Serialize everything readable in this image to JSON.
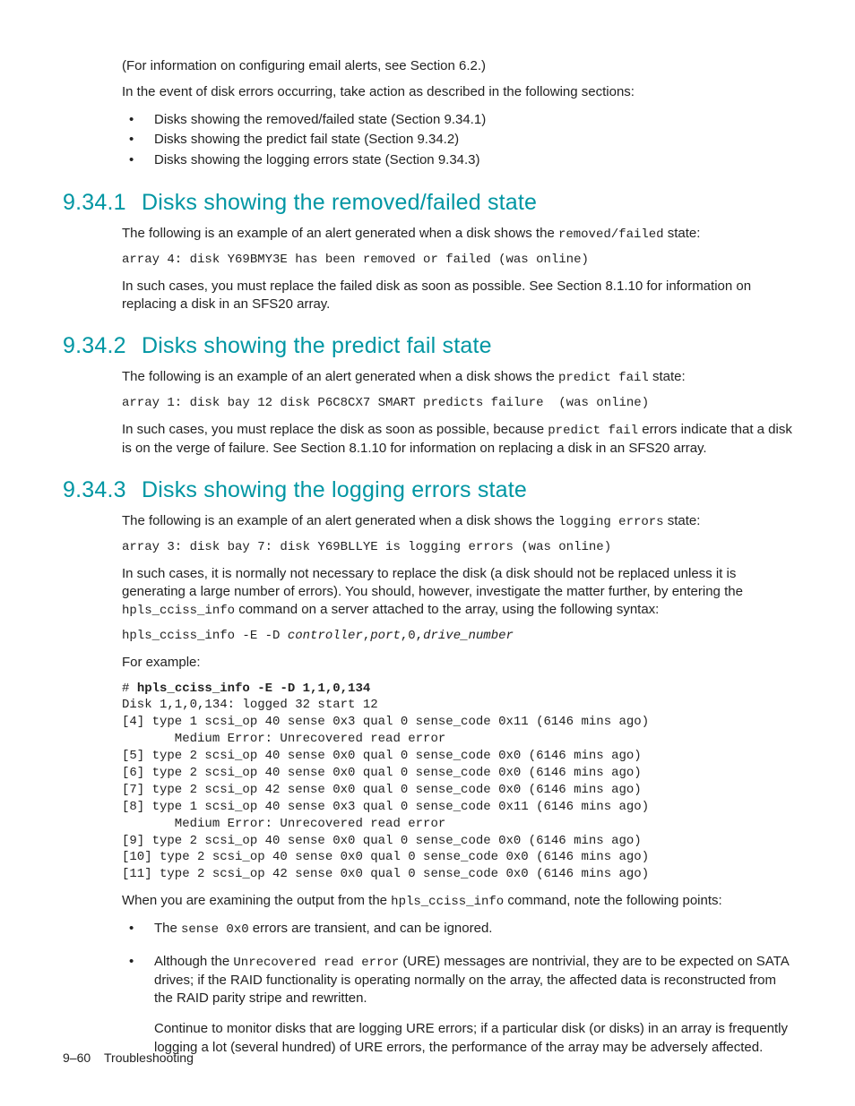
{
  "intro": {
    "p1": "(For information on configuring email alerts, see Section 6.2.)",
    "p2": "In the event of disk errors occurring, take action as described in the following sections:",
    "bullets": [
      "Disks showing the removed/failed state (Section 9.34.1)",
      "Disks showing the predict fail state (Section 9.34.2)",
      "Disks showing the logging errors state (Section 9.34.3)"
    ]
  },
  "s1": {
    "num": "9.34.1",
    "title": "Disks showing the removed/failed state",
    "p1a": "The following is an example of an alert generated when a disk shows the ",
    "p1code": "removed/failed",
    "p1b": " state:",
    "code1": "array 4: disk Y69BMY3E has been removed or failed (was online)",
    "p2": "In such cases, you must replace the failed disk as soon as possible. See Section 8.1.10 for information on replacing a disk in an SFS20 array."
  },
  "s2": {
    "num": "9.34.2",
    "title": "Disks showing the predict fail state",
    "p1a": "The following is an example of an alert generated when a disk shows the ",
    "p1code": "predict fail",
    "p1b": " state:",
    "code1": "array 1: disk bay 12 disk P6C8CX7 SMART predicts failure  (was online)",
    "p2a": "In such cases, you must replace the disk as soon as possible, because ",
    "p2code": "predict fail",
    "p2b": " errors indicate that a disk is on the verge of failure. See Section 8.1.10 for information on replacing a disk in an SFS20 array."
  },
  "s3": {
    "num": "9.34.3",
    "title": "Disks showing the logging errors state",
    "p1a": "The following is an example of an alert generated when a disk shows the ",
    "p1code": "logging errors",
    "p1b": " state:",
    "code1": "array 3: disk bay 7: disk Y69BLLYE is logging errors (was online)",
    "p2a": "In such cases, it is normally not necessary to replace the disk (a disk should not be replaced unless it is generating a large number of errors). You should, however, investigate the matter further, by entering the ",
    "p2code": "hpls_cciss_info",
    "p2b": " command on a server attached to the array, using the following syntax:",
    "syntax_a": "hpls_cciss_info -E -D ",
    "syntax_b": "controller",
    "syntax_c": ",",
    "syntax_d": "port",
    "syntax_e": ",0,",
    "syntax_f": "drive_number",
    "p3": "For example:",
    "example_cmd": "hpls_cciss_info -E -D 1,1,0,134",
    "example_out": "Disk 1,1,0,134: logged 32 start 12\n[4] type 1 scsi_op 40 sense 0x3 qual 0 sense_code 0x11 (6146 mins ago)\n       Medium Error: Unrecovered read error\n[5] type 2 scsi_op 40 sense 0x0 qual 0 sense_code 0x0 (6146 mins ago)\n[6] type 2 scsi_op 40 sense 0x0 qual 0 sense_code 0x0 (6146 mins ago)\n[7] type 2 scsi_op 42 sense 0x0 qual 0 sense_code 0x0 (6146 mins ago)\n[8] type 1 scsi_op 40 sense 0x3 qual 0 sense_code 0x11 (6146 mins ago)\n       Medium Error: Unrecovered read error\n[9] type 2 scsi_op 40 sense 0x0 qual 0 sense_code 0x0 (6146 mins ago)\n[10] type 2 scsi_op 40 sense 0x0 qual 0 sense_code 0x0 (6146 mins ago)\n[11] type 2 scsi_op 42 sense 0x0 qual 0 sense_code 0x0 (6146 mins ago)",
    "p4a": "When you are examining the output from the ",
    "p4code": "hpls_cciss_info",
    "p4b": " command, note the following points:",
    "n1a": "The ",
    "n1code": "sense 0x0",
    "n1b": " errors are transient, and can be ignored.",
    "n2a": "Although the ",
    "n2code": "Unrecovered read error",
    "n2b": " (URE) messages are nontrivial, they are to be expected on SATA drives; if the RAID functionality is operating normally on the array, the affected data is reconstructed from the RAID parity stripe and rewritten.",
    "n2c": "Continue to monitor disks that are logging URE errors; if a particular disk (or disks) in an array is frequently logging a lot (several hundred) of URE errors, the performance of the array may be adversely affected."
  },
  "footer": {
    "page": "9–60",
    "chapter": "Troubleshooting"
  }
}
